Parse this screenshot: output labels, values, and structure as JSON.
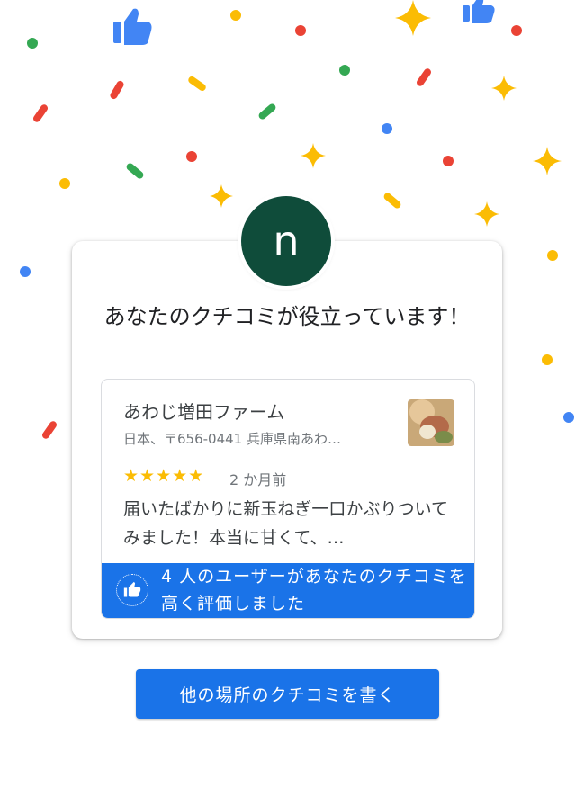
{
  "avatar": {
    "letter": "n"
  },
  "headline": "あなたのクチコミが役立っています！",
  "review": {
    "place_name": "あわじ増田ファーム",
    "address": "日本、〒656-0441 兵庫県南あわ…",
    "rating": 5,
    "stars_text": "★★★★★",
    "time": "2 か月前",
    "text": "届いたばかりに新玉ねぎ一口かぶりついてみました！本当に甘くて、…"
  },
  "banner": {
    "text": "4 人のユーザーがあなたのクチコミを高く評価しました"
  },
  "cta": {
    "label": "他の場所のクチコミを書く"
  },
  "colors": {
    "accent": "#1a73e8",
    "avatar_bg": "#0f4c3a",
    "star": "#fbbc04",
    "confetti": [
      "#ea4335",
      "#fbbc04",
      "#34a853",
      "#4285f4"
    ]
  }
}
